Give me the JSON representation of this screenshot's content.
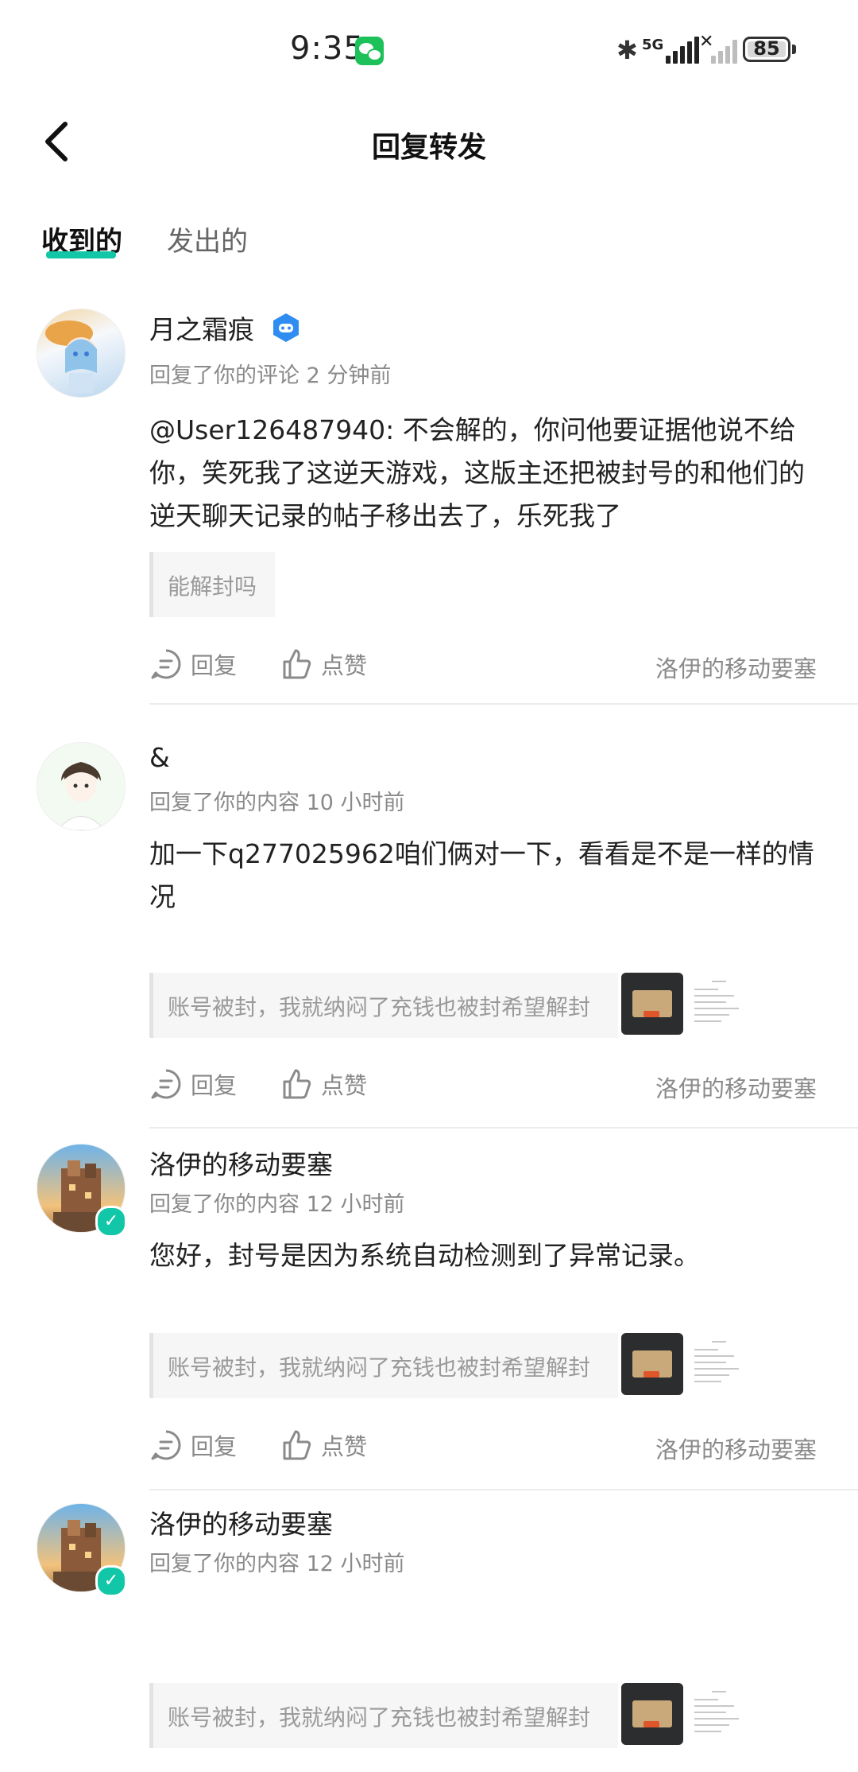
{
  "status_bar": {
    "time": "9:35",
    "network": "5G",
    "battery": "85"
  },
  "header": {
    "title": "回复转发"
  },
  "tabs": [
    {
      "label": "收到的",
      "active": true
    },
    {
      "label": "发出的",
      "active": false
    }
  ],
  "colors": {
    "accent": "#12c7a7",
    "muted": "#8a8a8a",
    "quote_bg": "#f6f6f6"
  },
  "items": [
    {
      "name": "月之霜痕",
      "meta": "回复了你的评论 2 分钟前",
      "content": "@User126487940: 不会解的，你问他要证据他说不给你，笑死我了这逆天游戏，这版主还把被封号的和他们的逆天聊天记录的帖子移出去了，乐死我了",
      "quote": "能解封吗",
      "reply_label": "回复",
      "like_label": "点赞",
      "source": "洛伊的移动要塞"
    },
    {
      "name": "&",
      "meta": "回复了你的内容 10 小时前",
      "content": "加一下q277025962咱们俩对一下，看看是不是一样的情况",
      "quote": "账号被封，我就纳闷了充钱也被封希望解封",
      "reply_label": "回复",
      "like_label": "点赞",
      "source": "洛伊的移动要塞"
    },
    {
      "name": "洛伊的移动要塞",
      "meta": "回复了你的内容 12 小时前",
      "content": "您好，封号是因为系统自动检测到了异常记录。",
      "quote": "账号被封，我就纳闷了充钱也被封希望解封",
      "reply_label": "回复",
      "like_label": "点赞",
      "source": "洛伊的移动要塞"
    },
    {
      "name": "洛伊的移动要塞",
      "meta": "回复了你的内容 12 小时前",
      "content": "",
      "quote": "账号被封，我就纳闷了充钱也被封希望解封"
    }
  ]
}
